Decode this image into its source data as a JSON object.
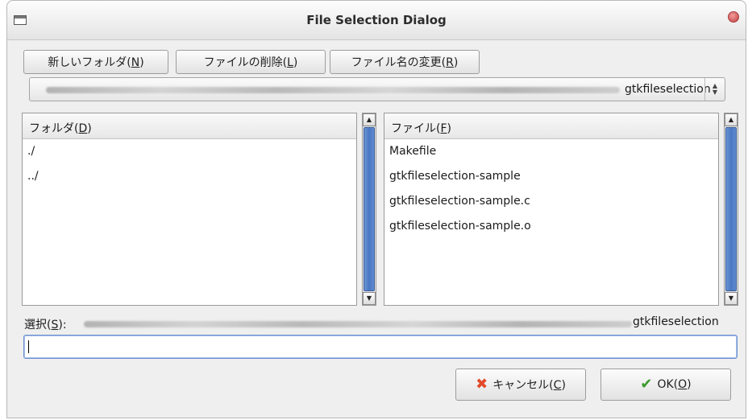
{
  "window": {
    "title": "File Selection Dialog"
  },
  "toolbar": {
    "new_folder": {
      "text": "新しいフォルダ(",
      "mnemonic": "N",
      "suffix": ")"
    },
    "delete_file": {
      "text": "ファイルの削除(",
      "mnemonic": "L",
      "suffix": ")"
    },
    "rename_file": {
      "text": "ファイル名の変更(",
      "mnemonic": "R",
      "suffix": ")"
    }
  },
  "path_combo": {
    "visible_tail": "gtkfileselection"
  },
  "folders_pane": {
    "header": {
      "text": "フォルダ(",
      "mnemonic": "D",
      "suffix": ")"
    },
    "items": [
      "./",
      "../"
    ]
  },
  "files_pane": {
    "header": {
      "text": "ファイル(",
      "mnemonic": "F",
      "suffix": ")"
    },
    "items": [
      "Makefile",
      "gtkfileselection-sample",
      "gtkfileselection-sample.c",
      "gtkfileselection-sample.o"
    ]
  },
  "selection": {
    "label": {
      "text": "選択(",
      "mnemonic": "S",
      "suffix": "):"
    },
    "path_tail": "gtkfileselection",
    "input_value": ""
  },
  "actions": {
    "cancel": {
      "text": "キャンセル(",
      "mnemonic": "C",
      "suffix": ")",
      "icon": "cancel-x-icon"
    },
    "ok": {
      "text": "OK(",
      "mnemonic": "O",
      "suffix": ")",
      "icon": "checkmark-icon"
    }
  },
  "colors": {
    "scroll_thumb": "#4a77c3",
    "input_focus": "#6b8fcf",
    "cancel_icon": "#e24a2a",
    "ok_icon": "#3a9a2a"
  }
}
